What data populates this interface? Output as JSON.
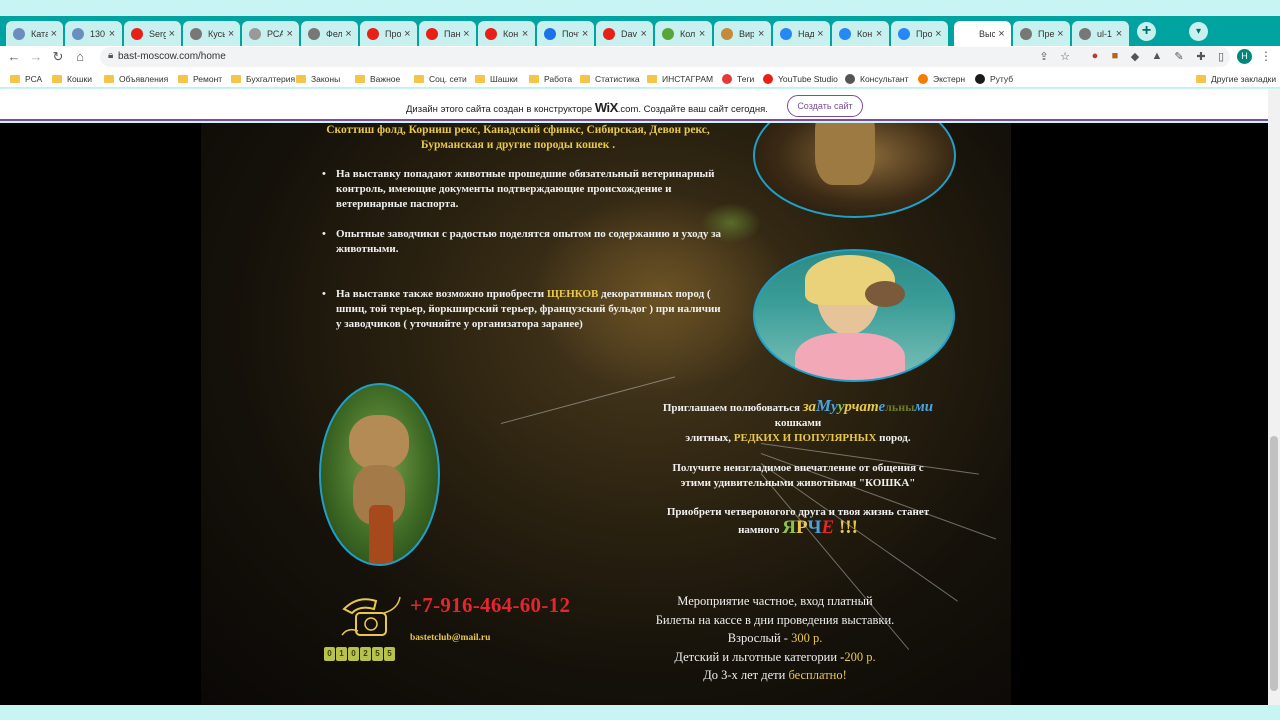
{
  "browser": {
    "tabs": [
      {
        "label": "Ката",
        "icon": "globe-icon",
        "color": "#6c8ebf"
      },
      {
        "label": "130",
        "icon": "globe-icon",
        "color": "#6c8ebf"
      },
      {
        "label": "Serg",
        "icon": "youtube-icon",
        "color": "#e62117"
      },
      {
        "label": "Кусы",
        "icon": "globe-icon",
        "color": "#777777"
      },
      {
        "label": "РСА",
        "icon": "p-icon",
        "color": "#999999"
      },
      {
        "label": "Фел",
        "icon": "globe-icon",
        "color": "#777777"
      },
      {
        "label": "Про",
        "icon": "youtube-icon",
        "color": "#e62117"
      },
      {
        "label": "Пан",
        "icon": "youtube-icon",
        "color": "#e62117"
      },
      {
        "label": "Кон",
        "icon": "youtube-icon",
        "color": "#e62117"
      },
      {
        "label": "Почт",
        "icon": "mail-icon",
        "color": "#1a73e8"
      },
      {
        "label": "Davi",
        "icon": "youtube-icon",
        "color": "#e62117"
      },
      {
        "label": "Кол",
        "icon": "leaf-icon",
        "color": "#57a639"
      },
      {
        "label": "Вир",
        "icon": "cat-icon",
        "color": "#c38b3a"
      },
      {
        "label": "Над",
        "icon": "vk-icon",
        "color": "#2787f5"
      },
      {
        "label": "Кон",
        "icon": "vk-icon",
        "color": "#2787f5"
      },
      {
        "label": "Про",
        "icon": "vk-icon",
        "color": "#2787f5"
      },
      {
        "label": "Выс",
        "icon": "none",
        "color": "#ffffff",
        "active": true
      },
      {
        "label": "Пре",
        "icon": "globe-icon",
        "color": "#777777"
      },
      {
        "label": "ul-1",
        "icon": "globe-icon",
        "color": "#777777"
      }
    ],
    "new_tab": "+",
    "url": "bast-moscow.com/home",
    "profile_initial": "H",
    "bookmarks": [
      {
        "label": "РСА",
        "type": "folder"
      },
      {
        "label": "Кошки",
        "type": "folder"
      },
      {
        "label": "Объявления",
        "type": "folder"
      },
      {
        "label": "Ремонт",
        "type": "folder"
      },
      {
        "label": "Бухгалтерия",
        "type": "folder"
      },
      {
        "label": "Законы",
        "type": "folder"
      },
      {
        "label": "Важное",
        "type": "folder"
      },
      {
        "label": "Соц. сети",
        "type": "folder"
      },
      {
        "label": "Шашки",
        "type": "folder"
      },
      {
        "label": "Работа",
        "type": "folder"
      },
      {
        "label": "Статистика",
        "type": "folder"
      },
      {
        "label": "ИНСТАГРАМ",
        "type": "folder"
      },
      {
        "label": "Теги",
        "type": "site",
        "color": "#e53935"
      },
      {
        "label": "YouTube Studio",
        "type": "site",
        "color": "#e62117"
      },
      {
        "label": "Консультант",
        "type": "site",
        "color": "#555555"
      },
      {
        "label": "Экстерн",
        "type": "site",
        "color": "#f57c00"
      },
      {
        "label": "Рутуб",
        "type": "site",
        "color": "#1a1a1a"
      }
    ],
    "other_bookmarks": "Другие закладки"
  },
  "wix_banner": {
    "text_before": "Дизайн этого сайта создан в конструкторе",
    "logo": "WiX",
    "text_after": ".com. Создайте ваш сайт сегодня.",
    "button": "Создать сайт"
  },
  "content": {
    "breeds_line1": "Скоттиш фолд, Корниш рекс, Канадский сфинкс, Сибирская,  Девон рекс,",
    "breeds_line2": "Бурманская  и  другие породы кошек .",
    "bullet1": "На выставку попадают животные прошедшие обязательный ветеринарный контроль, имеющие документы подтверждающие происхождение и ветеринарные паспорта.",
    "bullet2": "Опытные заводчики с радостью поделятся опытом  по содержанию и уходу за животными.",
    "bullet3_a": "На выставке также возможно приобрести ",
    "bullet3_puppies": "ЩЕНКОВ",
    "bullet3_b": " декоративных пород ( шпиц, той терьер, йоркширский терьер, французский бульдог ) при наличии у заводчиков ( уточняйте у организатора заранее)",
    "promo_invite": "Приглашаем полюбоваться ",
    "promo_fancy": [
      "за",
      "М",
      "у",
      "у",
      "р",
      "ч",
      "ат",
      "е",
      "льны",
      "ми"
    ],
    "promo_cats": "кошками",
    "promo_elite": "элитных, ",
    "promo_rare": "РЕДКИХ И ПОПУЛЯРНЫХ",
    "promo_breeds": " пород.",
    "promo_impression": "Получите неизгладимое впечатление от общения с этими удивительными животными \"КОШКА\"",
    "promo_friend": "Приобрети четвероногого друга и твоя жизнь станет намного ",
    "promo_bright": [
      "Я",
      "Р",
      "Ч",
      "Е"
    ],
    "promo_exclaim": " !!!",
    "phone": "+7-916-464-60-12",
    "email": "bastetclub@mail.ru",
    "counter_digits": [
      "0",
      "1",
      "0",
      "2",
      "5",
      "5"
    ],
    "price_line1": "Мероприятие частное, вход платный",
    "price_line2": "Билеты на кассе в дни проведения выставки.",
    "price_adult_label": "Взрослый - ",
    "price_adult_value": "300 р.",
    "price_child_label": "Детский и льготные категории -",
    "price_child_value": "200 р.",
    "price_kids_label": "До 3-х лет дети ",
    "price_kids_value": "бесплатно!"
  },
  "colors": {
    "tabbar": "#00a39f",
    "accent_yellow": "#e7c84b",
    "phone_red": "#e5262d",
    "wix_purple": "#7d4d97",
    "circle_border": "#1fa0c8"
  }
}
